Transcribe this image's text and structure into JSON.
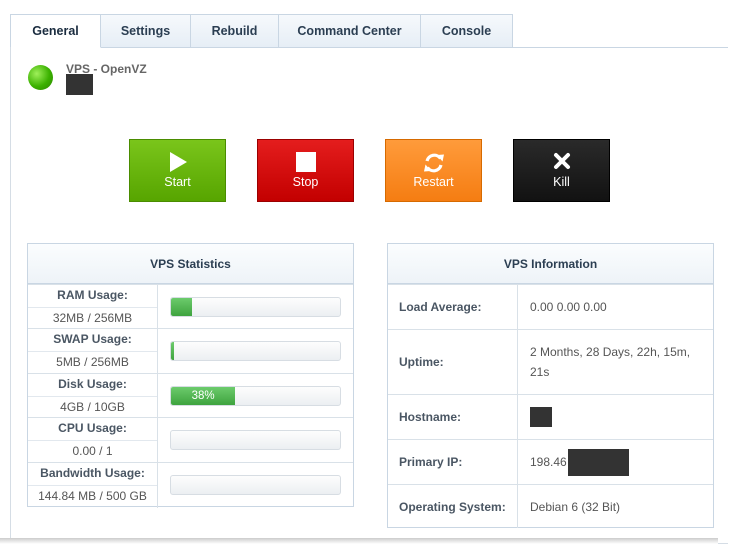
{
  "tabs": [
    {
      "label": "General",
      "active": true
    },
    {
      "label": "Settings",
      "active": false
    },
    {
      "label": "Rebuild",
      "active": false
    },
    {
      "label": "Command Center",
      "active": false
    },
    {
      "label": "Console",
      "active": false
    }
  ],
  "vps": {
    "title": "VPS - OpenVZ",
    "status_color": "#3bb100"
  },
  "controls": {
    "start": "Start",
    "stop": "Stop",
    "restart": "Restart",
    "kill": "Kill"
  },
  "stats": {
    "heading": "VPS Statistics",
    "rows": [
      {
        "label": "RAM Usage:",
        "value": "32MB / 256MB",
        "percent": 12.5,
        "bar_text": ""
      },
      {
        "label": "SWAP Usage:",
        "value": "5MB / 256MB",
        "percent": 2,
        "bar_text": ""
      },
      {
        "label": "Disk Usage:",
        "value": "4GB / 10GB",
        "percent": 38,
        "bar_text": "38%"
      },
      {
        "label": "CPU Usage:",
        "value": "0.00 / 1",
        "percent": 0,
        "bar_text": ""
      },
      {
        "label": "Bandwidth Usage:",
        "value": "144.84 MB / 500 GB",
        "percent": 0,
        "bar_text": ""
      }
    ]
  },
  "info": {
    "heading": "VPS Information",
    "load_label": "Load Average:",
    "load_value": "0.00 0.00 0.00",
    "uptime_label": "Uptime:",
    "uptime_value": "2 Months, 28 Days, 22h, 15m, 21s",
    "hostname_label": "Hostname:",
    "ip_label": "Primary IP:",
    "ip_value": "198.46",
    "os_label": "Operating System:",
    "os_value": "Debian 6 (32 Bit)"
  }
}
